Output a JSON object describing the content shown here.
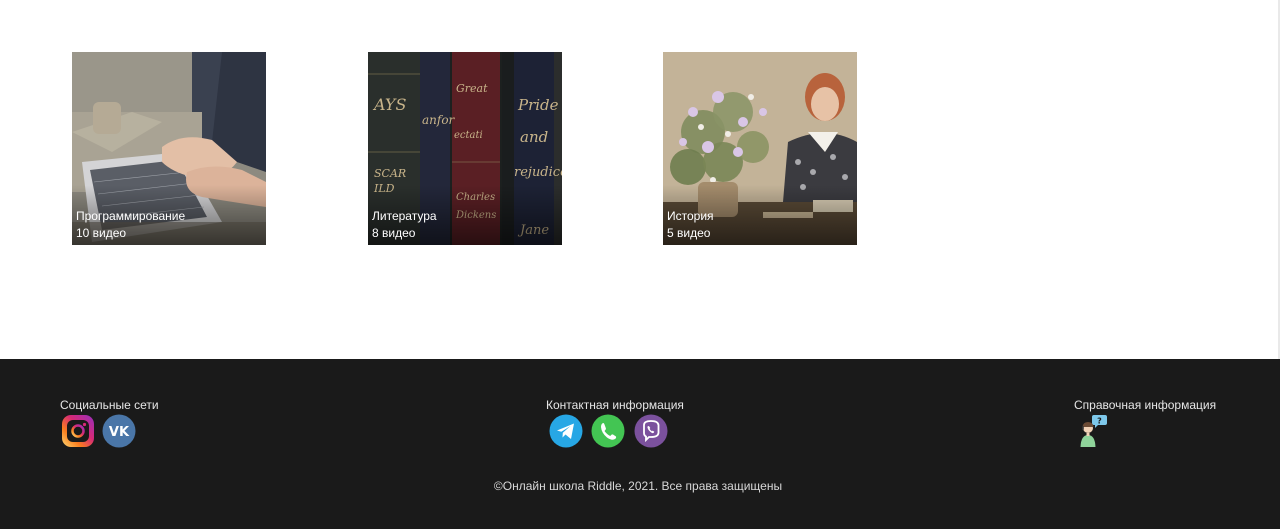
{
  "courses": [
    {
      "title": "Программирование",
      "count": "10 видео",
      "image": "laptop-photo"
    },
    {
      "title": "Литература",
      "count": "8 видео",
      "image": "books-photo"
    },
    {
      "title": "История",
      "count": "5 видео",
      "image": "flowers-woman-photo"
    }
  ],
  "footer": {
    "social_title": "Социальные сети",
    "social_icons": [
      "instagram-icon",
      "vk-icon"
    ],
    "contact_title": "Контактная информация",
    "contact_icons": [
      "telegram-icon",
      "whatsapp-icon",
      "viber-icon"
    ],
    "help_title": "Справочная информация",
    "help_icon": "support-agent-icon",
    "copyright": "©Онлайн школа Riddle, 2021. Все права защищены"
  },
  "colors": {
    "footer_bg": "#1a1a1a",
    "telegram": "#27a7e5",
    "whatsapp": "#43c553",
    "viber": "#7b519d",
    "vk": "#4a76a8"
  }
}
